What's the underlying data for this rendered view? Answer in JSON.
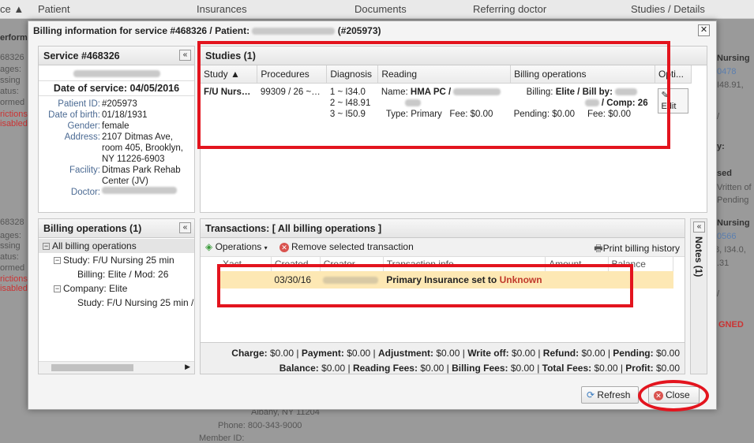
{
  "background": {
    "columns": [
      "ce ▲",
      "Patient",
      "Insurances",
      "Documents",
      "Referring doctor",
      "Studies / Details"
    ],
    "left_text": [
      "erform",
      "68326",
      "ages:",
      "ssing",
      "atus:",
      "ormed",
      "rictions",
      "isabled",
      "68328",
      "ages:",
      "ssing",
      "atus:",
      "ormed",
      "rictions",
      "isabled"
    ],
    "right_text": [
      "Nursing",
      "0478",
      "I48.91,",
      "/",
      "y:",
      "sed",
      "Vritten of",
      "Pending",
      "Nursing",
      "0566",
      "8, I34.0,",
      ".31",
      "/",
      "GNED"
    ],
    "bottom_text": [
      "Albany, NY 11204",
      "Phone: 800-343-9000",
      "Member ID:"
    ]
  },
  "dialog": {
    "title_prefix": "Billing information for service #468326 / Patient:",
    "title_suffix": "(#205973)",
    "close_x": "✕"
  },
  "service_panel": {
    "title": "Service #468326",
    "collapse": "«",
    "date_of_service": "Date of service: 04/05/2016",
    "fields": [
      {
        "label": "Patient ID:",
        "value": "#205973"
      },
      {
        "label": "Date of birth:",
        "value": "01/18/1931"
      },
      {
        "label": "Gender:",
        "value": "female"
      },
      {
        "label": "Address:",
        "value": "2107 Ditmas Ave, room 405, Brooklyn, NY 11226-6903"
      },
      {
        "label": "Facility:",
        "value": "Ditmas Park Rehab Center (JV)"
      },
      {
        "label": "Doctor:",
        "value": ""
      }
    ]
  },
  "studies_panel": {
    "title": "Studies (1)",
    "columns": [
      "Study ▲",
      "Procedures",
      "Diagnosis",
      "Reading",
      "Billing operations",
      "Opti..."
    ],
    "row": {
      "study": "F/U Nurs…",
      "procedures": "99309 / 26 ~…",
      "diagnosis": [
        "1 ~ I34.0",
        "2 ~ I48.91",
        "3 ~ I50.9"
      ],
      "reading_name_label": "Name:",
      "reading_name": "HMA PC /",
      "reading_type_label": "Type:",
      "reading_type": "Primary",
      "reading_fee_label": "Fee:",
      "reading_fee": "$0.00",
      "billing_label": "Billing:",
      "billing_value": "Elite / Bill by:",
      "billing_comp": "/ Comp: 26",
      "pending_label": "Pending:",
      "pending_value": "$0.00",
      "fee_label": "Fee:",
      "fee_value": "$0.00",
      "edit_label": "Edit"
    }
  },
  "billing_ops_panel": {
    "title": "Billing operations (1)",
    "collapse": "«",
    "tree": [
      {
        "label": "All billing operations",
        "level": 0,
        "box": "−"
      },
      {
        "label": "Study: F/U Nursing 25 min",
        "level": 1,
        "box": "−"
      },
      {
        "label": "Billing: Elite / Mod: 26",
        "level": 2,
        "box": ""
      },
      {
        "label": "Company: Elite",
        "level": 1,
        "box": "−"
      },
      {
        "label": "Study: F/U Nursing 25 min /",
        "level": 2,
        "box": ""
      }
    ]
  },
  "transactions_panel": {
    "title": "Transactions: [ All billing operations ]",
    "toolbar": {
      "operations": "Operations",
      "remove": "Remove selected transaction",
      "print": "Print billing history"
    },
    "columns": [
      "Xact",
      "Created",
      "Creator",
      "Transaction info",
      "Amount",
      "Balance"
    ],
    "row": {
      "created": "03/30/16",
      "info_prefix": "Primary Insurance set to",
      "info_value": "Unknown"
    },
    "summary_line1": [
      {
        "label": "Charge:",
        "value": "$0.00"
      },
      {
        "label": "Payment:",
        "value": "$0.00"
      },
      {
        "label": "Adjustment:",
        "value": "$0.00"
      },
      {
        "label": "Write off:",
        "value": "$0.00"
      },
      {
        "label": "Refund:",
        "value": "$0.00"
      },
      {
        "label": "Pending:",
        "value": "$0.00"
      }
    ],
    "summary_line2": [
      {
        "label": "Balance:",
        "value": "$0.00"
      },
      {
        "label": "Reading Fees:",
        "value": "$0.00"
      },
      {
        "label": "Billing Fees:",
        "value": "$0.00"
      },
      {
        "label": "Total Fees:",
        "value": "$0.00"
      },
      {
        "label": "Profit:",
        "value": "$0.00"
      }
    ]
  },
  "notes_panel": {
    "title": "Notes (1)",
    "collapse": "«"
  },
  "buttons": {
    "refresh": "Refresh",
    "close": "Close"
  },
  "colors": {
    "annotation": "#e3141e",
    "selected_row": "#fde8b4",
    "link_red": "#c0392b"
  }
}
